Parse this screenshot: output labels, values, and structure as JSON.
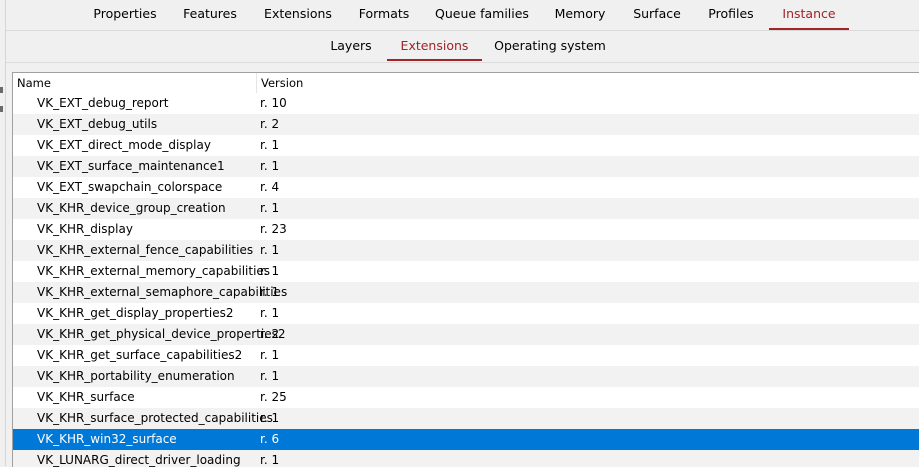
{
  "top_tabs": [
    {
      "label": "Properties"
    },
    {
      "label": "Features"
    },
    {
      "label": "Extensions"
    },
    {
      "label": "Formats"
    },
    {
      "label": "Queue families"
    },
    {
      "label": "Memory"
    },
    {
      "label": "Surface"
    },
    {
      "label": "Profiles"
    },
    {
      "label": "Instance"
    }
  ],
  "active_top_tab": "Instance",
  "sub_tabs": [
    {
      "label": "Layers"
    },
    {
      "label": "Extensions"
    },
    {
      "label": "Operating system"
    }
  ],
  "active_sub_tab": "Extensions",
  "table": {
    "headers": {
      "name": "Name",
      "version": "Version"
    },
    "rows": [
      {
        "name": "VK_EXT_debug_report",
        "version": "r. 10"
      },
      {
        "name": "VK_EXT_debug_utils",
        "version": "r. 2"
      },
      {
        "name": "VK_EXT_direct_mode_display",
        "version": "r. 1"
      },
      {
        "name": "VK_EXT_surface_maintenance1",
        "version": "r. 1"
      },
      {
        "name": "VK_EXT_swapchain_colorspace",
        "version": "r. 4"
      },
      {
        "name": "VK_KHR_device_group_creation",
        "version": "r. 1"
      },
      {
        "name": "VK_KHR_display",
        "version": "r. 23"
      },
      {
        "name": "VK_KHR_external_fence_capabilities",
        "version": "r. 1"
      },
      {
        "name": "VK_KHR_external_memory_capabilities",
        "version": "r. 1"
      },
      {
        "name": "VK_KHR_external_semaphore_capabilities",
        "version": "r. 1"
      },
      {
        "name": "VK_KHR_get_display_properties2",
        "version": "r. 1"
      },
      {
        "name": "VK_KHR_get_physical_device_properties2",
        "version": "r. 2"
      },
      {
        "name": "VK_KHR_get_surface_capabilities2",
        "version": "r. 1"
      },
      {
        "name": "VK_KHR_portability_enumeration",
        "version": "r. 1"
      },
      {
        "name": "VK_KHR_surface",
        "version": "r. 25"
      },
      {
        "name": "VK_KHR_surface_protected_capabilities",
        "version": "r. 1"
      },
      {
        "name": "VK_KHR_win32_surface",
        "version": "r. 6"
      },
      {
        "name": "VK_LUNARG_direct_driver_loading",
        "version": "r. 1"
      }
    ],
    "selected_row": "VK_KHR_win32_surface"
  },
  "colors": {
    "accent": "#a02428",
    "selection": "#0078d7"
  }
}
